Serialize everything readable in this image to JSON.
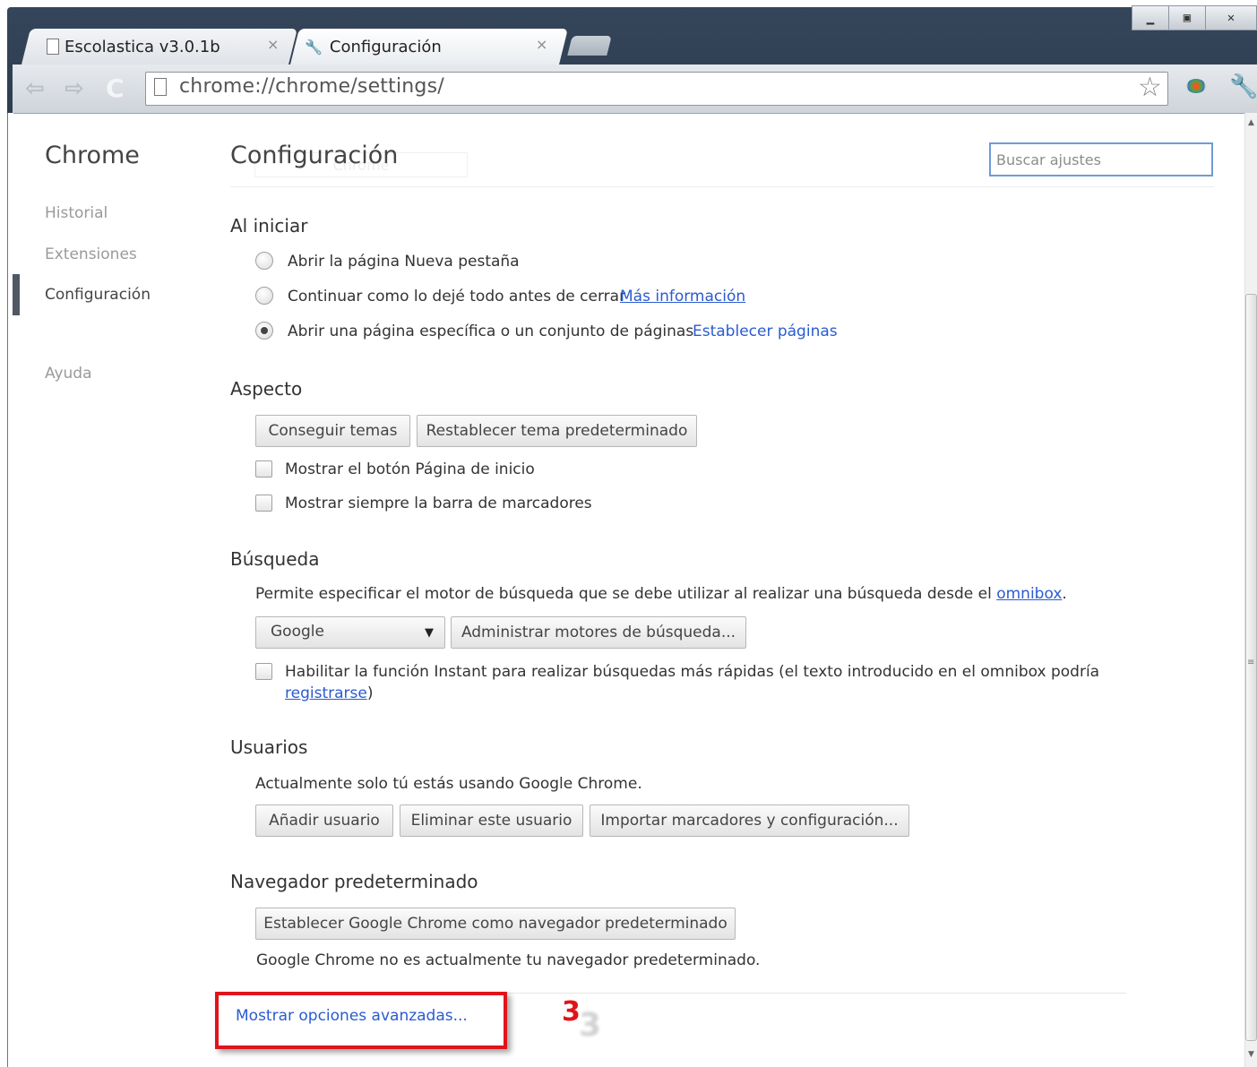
{
  "window": {
    "minimize": "▁",
    "maximize": "▣",
    "close": "✕"
  },
  "tabs": [
    {
      "title": "Escolastica v3.0.1b",
      "icon": "page-icon",
      "close": "×"
    },
    {
      "title": "Configuración",
      "icon": "wrench-icon",
      "close": "×"
    }
  ],
  "toolbar": {
    "url": "chrome://chrome/settings/",
    "back_icon": "⇦",
    "forward_icon": "⇨",
    "reload_icon": "C",
    "star_icon": "☆",
    "wrench_icon": "🔧"
  },
  "sidebar": {
    "title": "Chrome",
    "items": [
      {
        "label": "Historial"
      },
      {
        "label": "Extensiones"
      },
      {
        "label": "Configuración"
      },
      {
        "label": "Ayuda"
      }
    ]
  },
  "page": {
    "title": "Configuración",
    "ghost_tab": "Chrome",
    "search_placeholder": "Buscar ajustes"
  },
  "startup": {
    "title": "Al iniciar",
    "options": [
      {
        "label": "Abrir la página Nueva pestaña",
        "checked": false
      },
      {
        "label": "Continuar como lo dejé todo antes de cerrar",
        "link": "Más información",
        "checked": false
      },
      {
        "label": "Abrir una página específica o un conjunto de páginas",
        "link": "Establecer páginas",
        "checked": true
      }
    ]
  },
  "appearance": {
    "title": "Aspecto",
    "get_themes": "Conseguir temas",
    "reset_theme": "Restablecer tema predeterminado",
    "show_home": "Mostrar el botón Página de inicio",
    "show_bookmarks": "Mostrar siempre la barra de marcadores"
  },
  "search": {
    "title": "Búsqueda",
    "desc": "Permite especificar el motor de búsqueda que se debe utilizar al realizar una búsqueda desde el",
    "omnibox_link": "omnibox",
    "desc_end": ".",
    "engine": "Google",
    "arrow": "▼",
    "manage": "Administrar motores de búsqueda...",
    "instant": "Habilitar la función Instant para realizar búsquedas más rápidas (el texto introducido en el omnibox podría",
    "instant_link": "registrarse",
    "instant_end": ")"
  },
  "users": {
    "title": "Usuarios",
    "desc": "Actualmente solo tú estás usando Google Chrome.",
    "add": "Añadir usuario",
    "remove": "Eliminar este usuario",
    "import": "Importar marcadores y configuración..."
  },
  "default_browser": {
    "title": "Navegador predeterminado",
    "set_default": "Establecer Google Chrome como navegador predeterminado",
    "status": "Google Chrome no es actualmente tu navegador predeterminado."
  },
  "advanced": {
    "link": "Mostrar opciones avanzadas...",
    "step": "3",
    "step_shadow": "3"
  }
}
